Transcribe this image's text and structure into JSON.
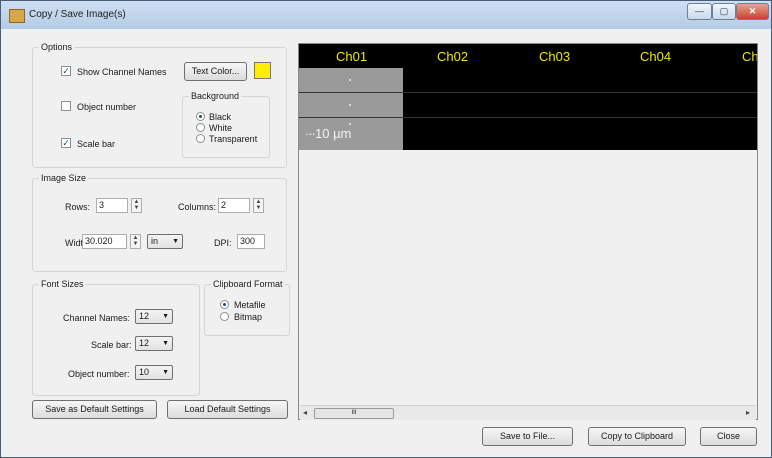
{
  "window": {
    "title": "Copy / Save Image(s)",
    "min_label": "—",
    "max_label": "▢",
    "close_label": "✕"
  },
  "options": {
    "group_label": "Options",
    "show_channel_names": {
      "label": "Show Channel Names",
      "checked": true
    },
    "text_color_button": "Text Color...",
    "text_color": "#ffee00",
    "object_number": {
      "label": "Object number",
      "checked": false
    },
    "scale_bar": {
      "label": "Scale bar",
      "checked": true
    },
    "background": {
      "group_label": "Background",
      "options": [
        "Black",
        "White",
        "Transparent"
      ],
      "selected": "Black"
    }
  },
  "image_size": {
    "group_label": "Image Size",
    "rows_label": "Rows:",
    "rows_value": "3",
    "columns_label": "Columns:",
    "columns_value": "2",
    "width_label": "Width:",
    "width_value": "30.020",
    "unit_value": "in",
    "dpi_label": "DPI:",
    "dpi_value": "300"
  },
  "font_sizes": {
    "group_label": "Font Sizes",
    "channel_names_label": "Channel Names:",
    "channel_names_value": "12",
    "scale_bar_label": "Scale bar:",
    "scale_bar_value": "12",
    "object_number_label": "Object number:",
    "object_number_value": "10"
  },
  "clipboard_format": {
    "group_label": "Clipboard Format",
    "options": [
      "Metafile",
      "Bitmap"
    ],
    "selected": "Metafile"
  },
  "buttons": {
    "save_default": "Save as Default Settings",
    "load_default": "Load Default Settings",
    "save_to_file": "Save to File...",
    "copy_to_clipboard": "Copy to Clipboard",
    "close": "Close"
  },
  "preview": {
    "channels": [
      "Ch01",
      "Ch02",
      "Ch03",
      "Ch04",
      "Ch"
    ],
    "scale_label": "10 µm",
    "scroll_thumb": "III"
  },
  "colors": {
    "channel_text": "#f2e600",
    "text_color_swatch": "#ffee00",
    "preview_background": "#000000"
  }
}
